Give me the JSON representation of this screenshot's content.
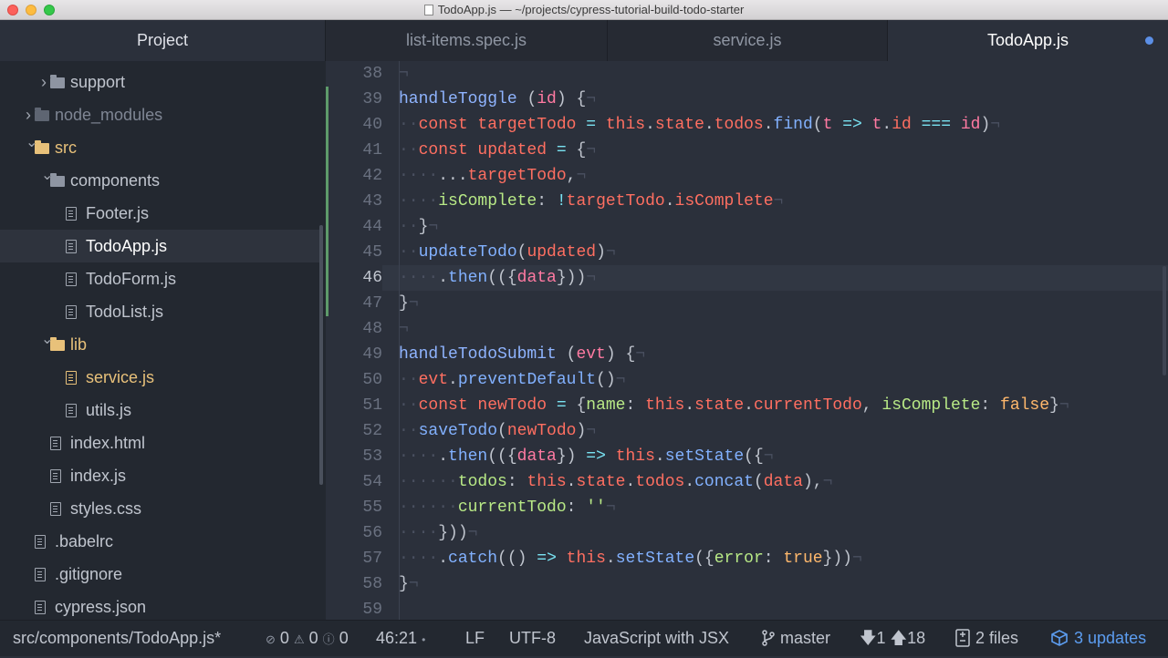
{
  "window": {
    "title": "TodoApp.js — ~/projects/cypress-tutorial-build-todo-starter"
  },
  "sidebar": {
    "header": "Project",
    "items": [
      {
        "label": "support",
        "type": "folder",
        "state": "collapsed",
        "depth": 2
      },
      {
        "label": "node_modules",
        "type": "folder",
        "state": "collapsed",
        "depth": 1,
        "dim": true
      },
      {
        "label": "src",
        "type": "folder",
        "state": "expanded",
        "depth": 1,
        "modified": true
      },
      {
        "label": "components",
        "type": "folder",
        "state": "expanded",
        "depth": 2
      },
      {
        "label": "Footer.js",
        "type": "file",
        "depth": 3
      },
      {
        "label": "TodoApp.js",
        "type": "file",
        "depth": 3,
        "selected": true
      },
      {
        "label": "TodoForm.js",
        "type": "file",
        "depth": 3
      },
      {
        "label": "TodoList.js",
        "type": "file",
        "depth": 3
      },
      {
        "label": "lib",
        "type": "folder",
        "state": "expanded",
        "depth": 2,
        "modified": true
      },
      {
        "label": "service.js",
        "type": "file",
        "depth": 3,
        "modified": true
      },
      {
        "label": "utils.js",
        "type": "file",
        "depth": 3
      },
      {
        "label": "index.html",
        "type": "file",
        "depth": 2
      },
      {
        "label": "index.js",
        "type": "file",
        "depth": 2
      },
      {
        "label": "styles.css",
        "type": "file",
        "depth": 2
      },
      {
        "label": ".babelrc",
        "type": "file",
        "depth": 1
      },
      {
        "label": ".gitignore",
        "type": "file",
        "depth": 1
      },
      {
        "label": "cypress.json",
        "type": "file",
        "depth": 1
      }
    ]
  },
  "tabs": [
    {
      "label": "list-items.spec.js",
      "active": false
    },
    {
      "label": "service.js",
      "active": false
    },
    {
      "label": "TodoApp.js",
      "active": true,
      "modified": true
    }
  ],
  "editor": {
    "current_line": 46,
    "modified_lines": [
      39,
      47
    ],
    "lines": [
      {
        "n": "38",
        "tokens": [
          [
            "ws",
            "¬"
          ]
        ]
      },
      {
        "n": "39",
        "tokens": [
          [
            "f",
            "handleToggle "
          ],
          [
            "pn",
            "("
          ],
          [
            "p",
            "id"
          ],
          [
            "pn",
            ") {"
          ],
          [
            "ws",
            "¬"
          ]
        ]
      },
      {
        "n": "40",
        "tokens": [
          [
            "ws",
            "··"
          ],
          [
            "k",
            "const "
          ],
          [
            "v",
            "targetTodo "
          ],
          [
            "op",
            "= "
          ],
          [
            "k",
            "this"
          ],
          [
            "pn",
            "."
          ],
          [
            "pr",
            "state"
          ],
          [
            "pn",
            "."
          ],
          [
            "pr",
            "todos"
          ],
          [
            "pn",
            "."
          ],
          [
            "fn",
            "find"
          ],
          [
            "pn",
            "("
          ],
          [
            "p",
            "t "
          ],
          [
            "op",
            "=> "
          ],
          [
            "p",
            "t"
          ],
          [
            "pn",
            "."
          ],
          [
            "pr",
            "id "
          ],
          [
            "op",
            "=== "
          ],
          [
            "p",
            "id"
          ],
          [
            "pn",
            ")"
          ],
          [
            "ws",
            "¬"
          ]
        ]
      },
      {
        "n": "41",
        "tokens": [
          [
            "ws",
            "··"
          ],
          [
            "k",
            "const "
          ],
          [
            "v",
            "updated "
          ],
          [
            "op",
            "= "
          ],
          [
            "pn",
            "{"
          ],
          [
            "ws",
            "¬"
          ]
        ]
      },
      {
        "n": "42",
        "tokens": [
          [
            "ws",
            "····"
          ],
          [
            "pn",
            "..."
          ],
          [
            "v",
            "targetTodo"
          ],
          [
            "pn",
            ","
          ],
          [
            "ws",
            "¬"
          ]
        ]
      },
      {
        "n": "43",
        "tokens": [
          [
            "ws",
            "····"
          ],
          [
            "key",
            "isComplete"
          ],
          [
            "pn",
            ": "
          ],
          [
            "op",
            "!"
          ],
          [
            "v",
            "targetTodo"
          ],
          [
            "pn",
            "."
          ],
          [
            "pr",
            "isComplete"
          ],
          [
            "ws",
            "¬"
          ]
        ]
      },
      {
        "n": "44",
        "tokens": [
          [
            "ws",
            "··"
          ],
          [
            "pn",
            "}"
          ],
          [
            "ws",
            "¬"
          ]
        ]
      },
      {
        "n": "45",
        "tokens": [
          [
            "ws",
            "··"
          ],
          [
            "fn",
            "updateTodo"
          ],
          [
            "pn",
            "("
          ],
          [
            "v",
            "updated"
          ],
          [
            "pn",
            ")"
          ],
          [
            "ws",
            "¬"
          ]
        ]
      },
      {
        "n": "46",
        "tokens": [
          [
            "ws",
            "····"
          ],
          [
            "pn",
            "."
          ],
          [
            "fn",
            "then"
          ],
          [
            "pn",
            "(({"
          ],
          [
            "p",
            "data"
          ],
          [
            "pn",
            "}))"
          ],
          [
            "ws",
            "¬"
          ]
        ]
      },
      {
        "n": "47",
        "tokens": [
          [
            "pn",
            "}"
          ],
          [
            "ws",
            "¬"
          ]
        ]
      },
      {
        "n": "48",
        "tokens": [
          [
            "ws",
            "¬"
          ]
        ]
      },
      {
        "n": "49",
        "tokens": [
          [
            "f",
            "handleTodoSubmit "
          ],
          [
            "pn",
            "("
          ],
          [
            "p",
            "evt"
          ],
          [
            "pn",
            ") {"
          ],
          [
            "ws",
            "¬"
          ]
        ]
      },
      {
        "n": "50",
        "tokens": [
          [
            "ws",
            "··"
          ],
          [
            "v",
            "evt"
          ],
          [
            "pn",
            "."
          ],
          [
            "fn",
            "preventDefault"
          ],
          [
            "pn",
            "()"
          ],
          [
            "ws",
            "¬"
          ]
        ]
      },
      {
        "n": "51",
        "tokens": [
          [
            "ws",
            "··"
          ],
          [
            "k",
            "const "
          ],
          [
            "v",
            "newTodo "
          ],
          [
            "op",
            "= "
          ],
          [
            "pn",
            "{"
          ],
          [
            "key",
            "name"
          ],
          [
            "pn",
            ": "
          ],
          [
            "k",
            "this"
          ],
          [
            "pn",
            "."
          ],
          [
            "pr",
            "state"
          ],
          [
            "pn",
            "."
          ],
          [
            "pr",
            "currentTodo"
          ],
          [
            "pn",
            ", "
          ],
          [
            "key",
            "isComplete"
          ],
          [
            "pn",
            ": "
          ],
          [
            "b",
            "false"
          ],
          [
            "pn",
            "}"
          ],
          [
            "ws",
            "¬"
          ]
        ]
      },
      {
        "n": "52",
        "tokens": [
          [
            "ws",
            "··"
          ],
          [
            "fn",
            "saveTodo"
          ],
          [
            "pn",
            "("
          ],
          [
            "v",
            "newTodo"
          ],
          [
            "pn",
            ")"
          ],
          [
            "ws",
            "¬"
          ]
        ]
      },
      {
        "n": "53",
        "tokens": [
          [
            "ws",
            "····"
          ],
          [
            "pn",
            "."
          ],
          [
            "fn",
            "then"
          ],
          [
            "pn",
            "(({"
          ],
          [
            "p",
            "data"
          ],
          [
            "pn",
            "}) "
          ],
          [
            "op",
            "=> "
          ],
          [
            "k",
            "this"
          ],
          [
            "pn",
            "."
          ],
          [
            "fn",
            "setState"
          ],
          [
            "pn",
            "({"
          ],
          [
            "ws",
            "¬"
          ]
        ]
      },
      {
        "n": "54",
        "tokens": [
          [
            "ws",
            "······"
          ],
          [
            "key",
            "todos"
          ],
          [
            "pn",
            ": "
          ],
          [
            "k",
            "this"
          ],
          [
            "pn",
            "."
          ],
          [
            "pr",
            "state"
          ],
          [
            "pn",
            "."
          ],
          [
            "pr",
            "todos"
          ],
          [
            "pn",
            "."
          ],
          [
            "fn",
            "concat"
          ],
          [
            "pn",
            "("
          ],
          [
            "v",
            "data"
          ],
          [
            "pn",
            "),"
          ],
          [
            "ws",
            "¬"
          ]
        ]
      },
      {
        "n": "55",
        "tokens": [
          [
            "ws",
            "······"
          ],
          [
            "key",
            "currentTodo"
          ],
          [
            "pn",
            ": "
          ],
          [
            "s",
            "''"
          ],
          [
            "ws",
            "¬"
          ]
        ]
      },
      {
        "n": "56",
        "tokens": [
          [
            "ws",
            "····"
          ],
          [
            "pn",
            "}))"
          ],
          [
            "ws",
            "¬"
          ]
        ]
      },
      {
        "n": "57",
        "tokens": [
          [
            "ws",
            "····"
          ],
          [
            "pn",
            "."
          ],
          [
            "fn",
            "catch"
          ],
          [
            "pn",
            "(() "
          ],
          [
            "op",
            "=> "
          ],
          [
            "k",
            "this"
          ],
          [
            "pn",
            "."
          ],
          [
            "fn",
            "setState"
          ],
          [
            "pn",
            "({"
          ],
          [
            "key",
            "error"
          ],
          [
            "pn",
            ": "
          ],
          [
            "b",
            "true"
          ],
          [
            "pn",
            "}))"
          ],
          [
            "ws",
            "¬"
          ]
        ]
      },
      {
        "n": "58",
        "tokens": [
          [
            "pn",
            "}"
          ],
          [
            "ws",
            "¬"
          ]
        ]
      },
      {
        "n": "59",
        "tokens": []
      }
    ]
  },
  "statusbar": {
    "path": "src/components/TodoApp.js*",
    "errors": "0",
    "warnings": "0",
    "infos": "0",
    "cursor": "46:21",
    "line_ending": "LF",
    "encoding": "UTF-8",
    "grammar": "JavaScript with JSX",
    "branch": "master",
    "behind": "1",
    "ahead": "18",
    "files": "2 files",
    "updates": "3 updates"
  },
  "colors": {
    "accent": "#5c9df0",
    "git_added": "#5e9a6a",
    "modified": "#e8c17a"
  }
}
